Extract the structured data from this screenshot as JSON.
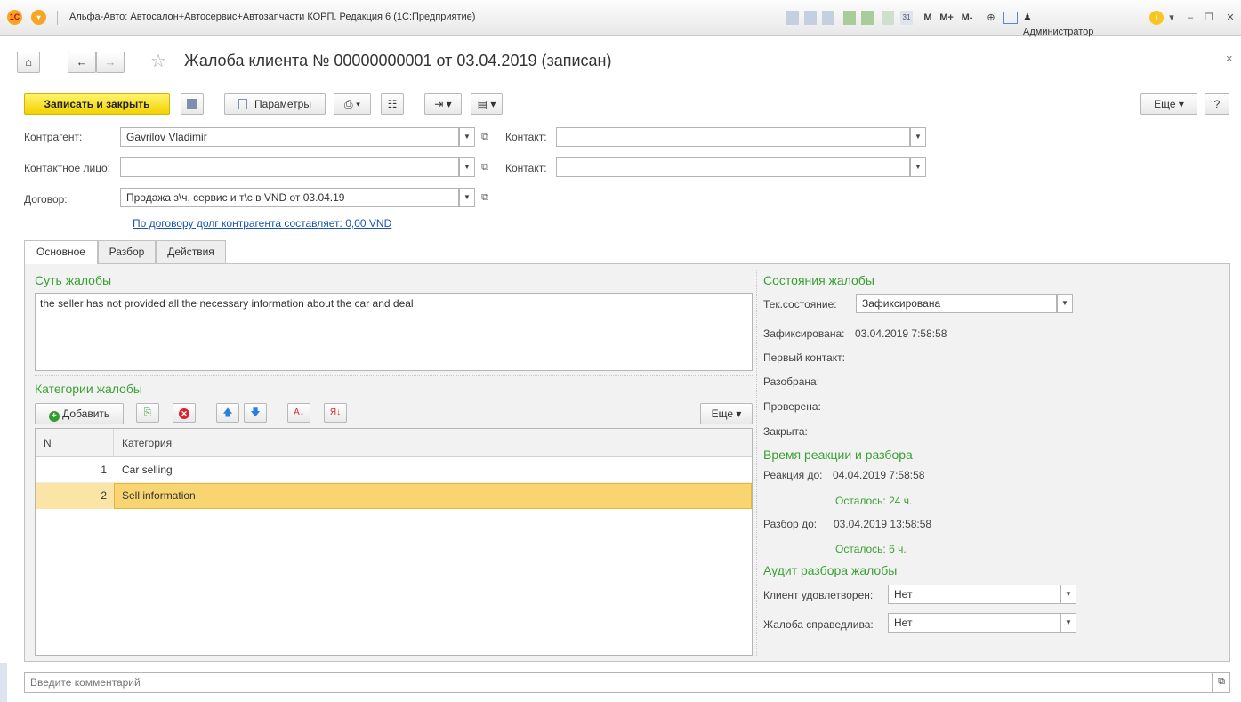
{
  "window": {
    "app_title": "Альфа-Авто: Автосалон+Автосервис+Автозапчасти КОРП. Редакция 6  (1С:Предприятие)",
    "title_icons": [
      "M",
      "M+",
      "M-"
    ],
    "user": "Администратор"
  },
  "header": {
    "title": "Жалоба клиента № 00000000001 от 03.04.2019 (записан)"
  },
  "toolbar": {
    "save_close": "Записать и закрыть",
    "params": "Параметры",
    "more": "Еще",
    "help": "?"
  },
  "form": {
    "counterparty_label": "Контрагент:",
    "counterparty": "Gavrilov Vladimir",
    "contact_label": "Контакт:",
    "contact_label2": "Контакт:",
    "contact_person_label": "Контактное лицо:",
    "contract_label": "Договор:",
    "contract": "Продажа з\\ч, сервис и т\\с в VND от 03.04.19",
    "debt_link": "По договору долг контрагента составляет: 0,00 VND"
  },
  "tabs": [
    "Основное",
    "Разбор",
    "Действия"
  ],
  "complaint": {
    "heading": "Суть жалобы",
    "text": "the seller has not provided all the necessary information about the car and deal"
  },
  "categories": {
    "heading": "Категории жалобы",
    "add": "Добавить",
    "more": "Еще",
    "col_n": "N",
    "col_cat": "Категория",
    "rows": [
      {
        "n": "1",
        "name": "Car selling"
      },
      {
        "n": "2",
        "name": "Sell information"
      }
    ]
  },
  "status": {
    "heading": "Состояния жалобы",
    "current_label": "Тек.состояние:",
    "current": "Зафиксирована",
    "fixed_label": "Зафиксирована:",
    "fixed": "03.04.2019 7:58:58",
    "first_contact_label": "Первый контакт:",
    "analyzed_label": "Разобрана:",
    "checked_label": "Проверена:",
    "closed_label": "Закрыта:"
  },
  "timing": {
    "heading": "Время реакции и разбора",
    "reaction_label": "Реакция до:",
    "reaction": "04.04.2019 7:58:58",
    "reaction_left": "Осталось: 24 ч.",
    "analysis_label": "Разбор до:",
    "analysis": "03.04.2019 13:58:58",
    "analysis_left": "Осталось: 6 ч."
  },
  "audit": {
    "heading": "Аудит разбора жалобы",
    "satisfied_label": "Клиент удовлетворен:",
    "satisfied": "Нет",
    "fair_label": "Жалоба справедлива:",
    "fair": "Нет"
  },
  "comment": {
    "placeholder": "Введите комментарий"
  }
}
